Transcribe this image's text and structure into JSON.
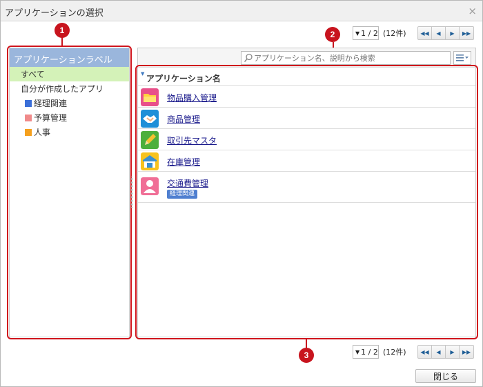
{
  "window": {
    "title": "アプリケーションの選択",
    "close_glyph": "×"
  },
  "pager": {
    "current": "1 / 2",
    "count": "(12件)"
  },
  "callouts": [
    "1",
    "2",
    "3"
  ],
  "labels": {
    "header": "アプリケーションラベル",
    "items": [
      {
        "label": "すべて",
        "selected": true
      },
      {
        "label": "自分が作成したアプリ",
        "selected": false
      },
      {
        "label": "経理関連",
        "color": "#3b6fd8"
      },
      {
        "label": "予算管理",
        "color": "#f08a8a"
      },
      {
        "label": "人事",
        "color": "#f5a01e"
      }
    ]
  },
  "search": {
    "placeholder": "アプリケーション名、説明から検索"
  },
  "list": {
    "column_header": "アプリケーション名",
    "apps": [
      {
        "name": "物品購入管理",
        "icon": "folder-icon"
      },
      {
        "name": "商品管理",
        "icon": "handshake-icon"
      },
      {
        "name": "取引先マスタ",
        "icon": "pencil-icon"
      },
      {
        "name": "在庫管理",
        "icon": "warehouse-icon"
      },
      {
        "name": "交通費管理",
        "icon": "person-icon",
        "tag": "経理関連"
      }
    ]
  },
  "footer": {
    "close_label": "閉じる"
  },
  "colors": {
    "accent_red": "#d0141c",
    "label_header": "#9ab6dc",
    "selected_row": "#d4f2b8",
    "link": "#1a1a8c"
  }
}
